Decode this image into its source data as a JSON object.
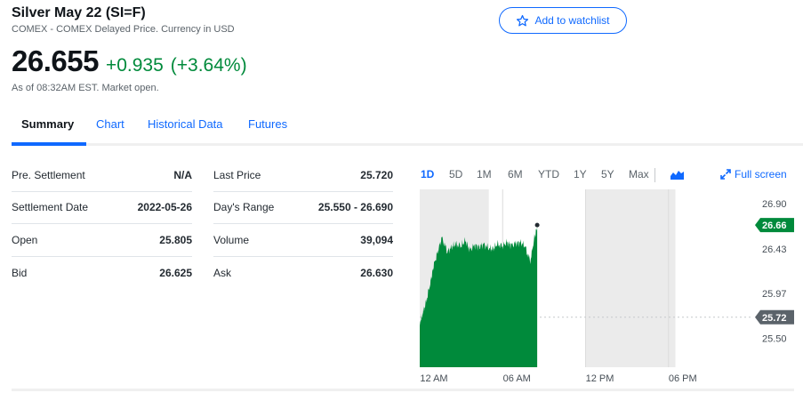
{
  "header": {
    "title": "Silver May 22 (SI=F)",
    "subtitle": "COMEX - COMEX Delayed Price. Currency in USD",
    "watchlist_label": "Add to watchlist",
    "price": "26.655",
    "change": "+0.935",
    "change_pct": "(+3.64%)",
    "as_of": "As of 08:32AM EST. Market open."
  },
  "tabs": [
    {
      "label": "Summary",
      "active": true
    },
    {
      "label": "Chart"
    },
    {
      "label": "Historical Data"
    },
    {
      "label": "Futures"
    }
  ],
  "stats_left": [
    {
      "label": "Pre. Settlement",
      "value": "N/A"
    },
    {
      "label": "Settlement Date",
      "value": "2022-05-26"
    },
    {
      "label": "Open",
      "value": "25.805"
    },
    {
      "label": "Bid",
      "value": "26.625"
    }
  ],
  "stats_right": [
    {
      "label": "Last Price",
      "value": "25.720"
    },
    {
      "label": "Day's Range",
      "value": "25.550 - 26.690"
    },
    {
      "label": "Volume",
      "value": "39,094"
    },
    {
      "label": "Ask",
      "value": "26.630"
    }
  ],
  "chart_controls": {
    "ranges": [
      "1D",
      "5D",
      "1M",
      "6M",
      "YTD",
      "1Y",
      "5Y",
      "Max"
    ],
    "active_range": "1D",
    "chart_type_icon": "mountain-chart-icon",
    "fullscreen_label": "Full screen",
    "fullscreen_icon": "expand-icon"
  },
  "colors": {
    "accent": "#0f69ff",
    "positive": "#008a3b",
    "area_fill": "#008a3b",
    "prev_close_label_bg": "#5b636a"
  },
  "chart_data": {
    "type": "area",
    "x_ticks": [
      "12 AM",
      "06 AM",
      "12 PM",
      "06 PM"
    ],
    "y_ticks": [
      26.9,
      26.43,
      25.97,
      25.5
    ],
    "y_tick_labels": [
      "26.90",
      "26.43",
      "25.97",
      "25.50"
    ],
    "ylim": [
      25.2,
      27.05
    ],
    "current_price_label": "26.66",
    "current_price": 26.66,
    "previous_close_label": "25.72",
    "previous_close": 25.72,
    "series": [
      {
        "x_hours": [
          0,
          0.2,
          0.5,
          0.8,
          1.0,
          1.3,
          1.6,
          2.0,
          2.3,
          2.6,
          3.0,
          3.3,
          3.6,
          4.0,
          4.3,
          4.6,
          5.0,
          5.3,
          5.6,
          6.0,
          6.3,
          6.6,
          7.0,
          7.3,
          7.6,
          8.0,
          8.3,
          8.5
        ],
        "values": [
          25.65,
          25.75,
          25.9,
          26.1,
          26.25,
          26.4,
          26.55,
          26.4,
          26.45,
          26.48,
          26.46,
          26.52,
          26.42,
          26.47,
          26.45,
          26.48,
          26.44,
          26.43,
          26.48,
          26.46,
          26.5,
          26.47,
          26.49,
          26.5,
          26.46,
          26.3,
          26.55,
          26.66
        ]
      }
    ],
    "grid": true
  }
}
